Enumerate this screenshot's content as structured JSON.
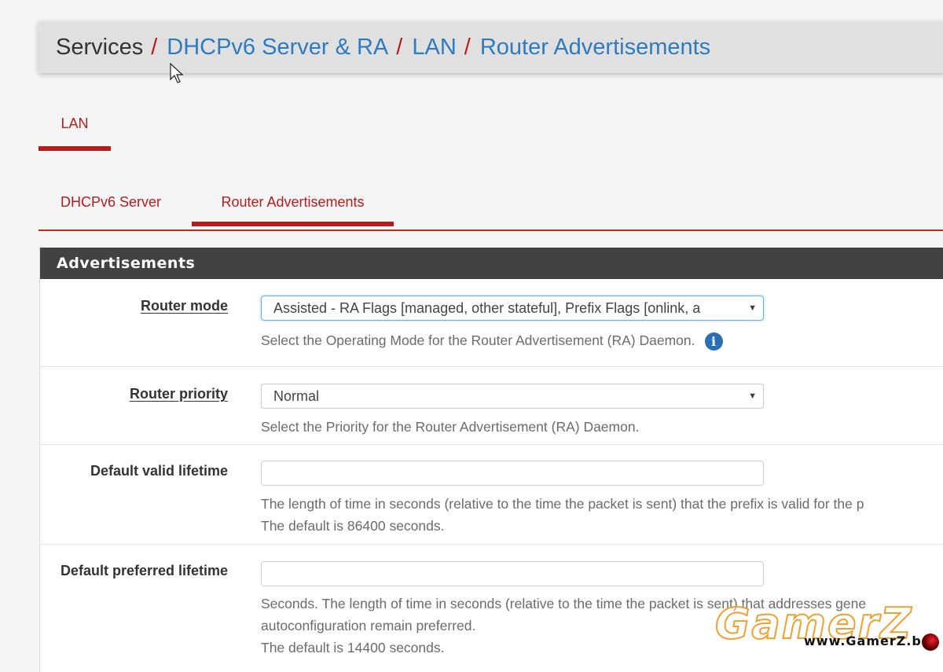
{
  "breadcrumb": {
    "items": [
      {
        "label": "Services",
        "link": false
      },
      {
        "label": "DHCPv6 Server & RA",
        "link": true
      },
      {
        "label": "LAN",
        "link": true
      },
      {
        "label": "Router Advertisements",
        "link": true
      }
    ],
    "separator": "/"
  },
  "interface_tabs": [
    {
      "label": "LAN",
      "active": true
    }
  ],
  "sub_tabs": [
    {
      "label": "DHCPv6 Server",
      "active": false
    },
    {
      "label": "Router Advertisements",
      "active": true
    }
  ],
  "panel": {
    "title": "Advertisements",
    "fields": [
      {
        "label": "Router mode",
        "type": "select",
        "value": "Assisted - RA Flags [managed, other stateful], Prefix Flags [onlink, a",
        "help": [
          "Select the Operating Mode for the Router Advertisement (RA) Daemon."
        ],
        "info_icon": "info-circle-icon"
      },
      {
        "label": "Router priority",
        "type": "select",
        "value": "Normal",
        "help": [
          "Select the Priority for the Router Advertisement (RA) Daemon."
        ]
      },
      {
        "label": "Default valid lifetime",
        "type": "text",
        "value": "",
        "help": [
          "The length of time in seconds (relative to the time the packet is sent) that the prefix is valid for the p",
          "The default is 86400 seconds."
        ]
      },
      {
        "label": "Default preferred lifetime",
        "type": "text",
        "value": "",
        "help": [
          "Seconds. The length of time in seconds (relative to the time the packet is sent) that addresses gene",
          "autoconfiguration remain preferred.",
          "The default is 14400 seconds."
        ]
      }
    ]
  },
  "select_arrow": "▼",
  "info_glyph": "i",
  "watermark": {
    "brand": "GamerZ",
    "url": "www.GamerZ.be"
  },
  "colors": {
    "accent_red": "#b71c1c",
    "link_blue": "#2f7bbf",
    "panel_heading_bg": "#424242",
    "info_blue": "#2a6fb5"
  }
}
